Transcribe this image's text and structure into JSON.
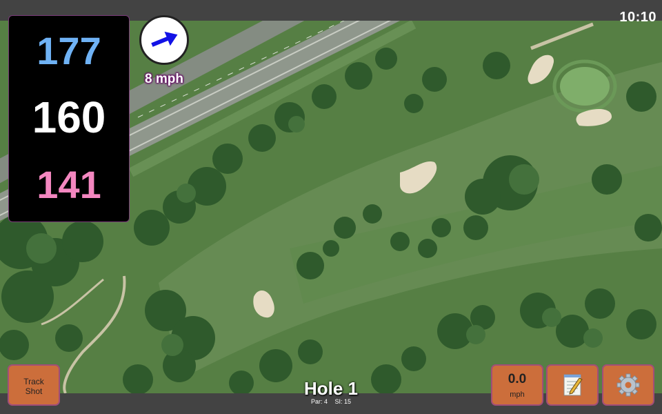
{
  "status_bar": {
    "time": "10:10"
  },
  "distances": {
    "back": "177",
    "center": "160",
    "front": "141",
    "back_color": "#6fb2f5",
    "center_color": "#ffffff",
    "front_color": "#f487c0"
  },
  "wind": {
    "label": "8 mph",
    "arrow_icon": "arrow-right-icon",
    "arrow_color": "#1212e6"
  },
  "buttons": {
    "track_shot_line1": "Track",
    "track_shot_line2": "Shot",
    "speed_value": "0.0",
    "speed_unit": "mph",
    "notes_icon": "notepad-icon",
    "settings_icon": "gear-icon"
  },
  "hole": {
    "title": "Hole 1",
    "par": "Par: 4",
    "stroke_index": "SI: 15"
  },
  "colors": {
    "button_bg": "#cc6e3b",
    "button_border": "#a24d78",
    "bar_bg": "#434343"
  }
}
